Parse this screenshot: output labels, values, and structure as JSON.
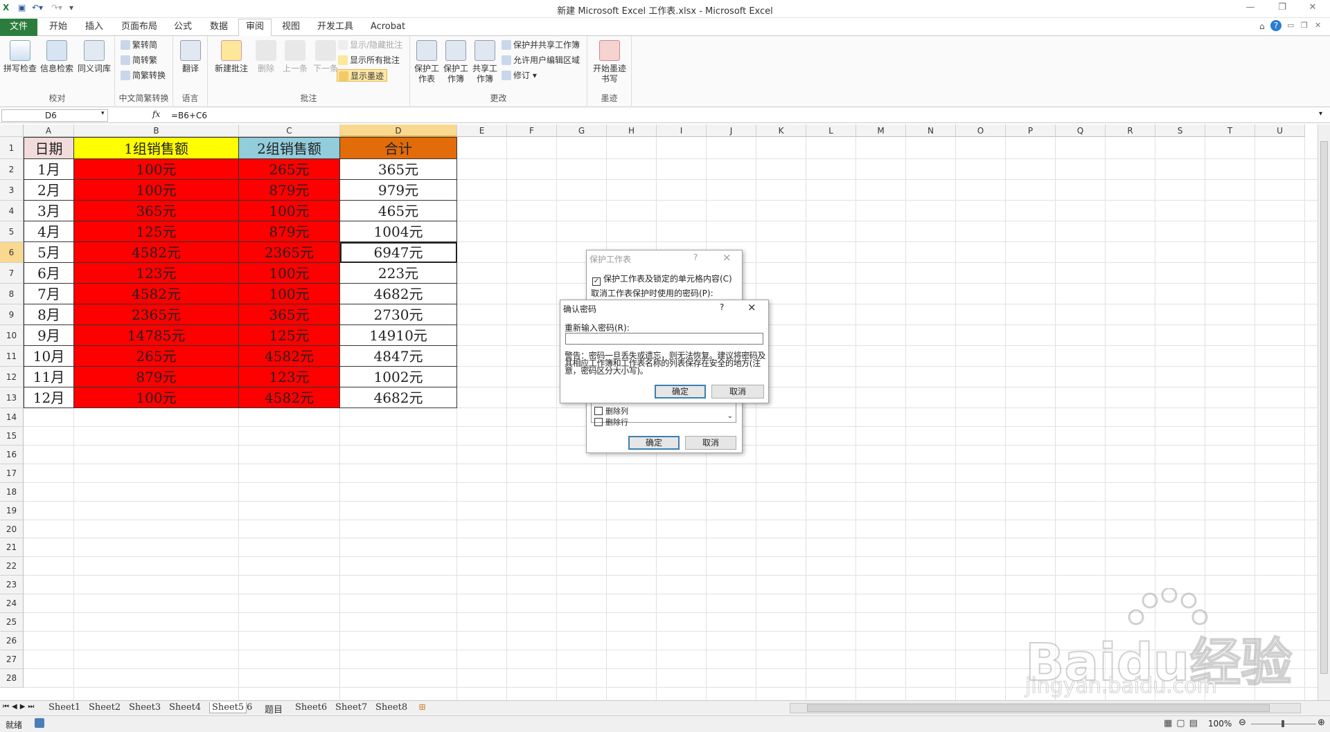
{
  "window": {
    "title": "新建 Microsoft Excel 工作表.xlsx - Microsoft Excel"
  },
  "tabs": [
    "文件",
    "开始",
    "插入",
    "页面布局",
    "公式",
    "数据",
    "审阅",
    "视图",
    "开发工具",
    "Acrobat"
  ],
  "active_tab": "审阅",
  "ribbon": {
    "proofing": {
      "label": "校对",
      "spell": "拼写检查",
      "research": "信息检索",
      "thesaurus": "同义词库"
    },
    "chinese": {
      "label": "中文简繁转换",
      "t2s": "繁转简",
      "s2t": "简转繁",
      "convert": "简繁转换"
    },
    "language": {
      "label": "语言",
      "translate": "翻译"
    },
    "comments": {
      "label": "批注",
      "new": "新建批注",
      "delete": "删除",
      "prev": "上一条",
      "next": "下一条",
      "show_hide": "显示/隐藏批注",
      "show_all": "显示所有批注",
      "show_ink": "显示墨迹"
    },
    "changes": {
      "label": "更改",
      "protect_sheet": "保护工作表",
      "protect_book": "保护工作簿",
      "share_book": "共享工作簿",
      "protect_share": "保护并共享工作簿",
      "allow_edit": "允许用户编辑区域",
      "track": "修订"
    },
    "ink": {
      "label": "墨迹",
      "start": "开始墨迹书写"
    }
  },
  "formula_bar": {
    "name_box": "D6",
    "fx": "fx",
    "formula": "=B6+C6"
  },
  "columns": [
    "A",
    "B",
    "C",
    "D",
    "E",
    "F",
    "G",
    "H",
    "I",
    "J",
    "K",
    "L",
    "M",
    "N",
    "O",
    "P",
    "Q",
    "R",
    "S",
    "T",
    "U"
  ],
  "rows": [
    "1",
    "2",
    "3",
    "4",
    "5",
    "6",
    "7",
    "8",
    "9",
    "10",
    "11",
    "12",
    "13",
    "14",
    "15",
    "16",
    "17",
    "18",
    "19",
    "20",
    "21",
    "22",
    "23",
    "24",
    "25",
    "26",
    "27",
    "28"
  ],
  "table": {
    "headers": [
      "日期",
      "1组销售额",
      "2组销售额",
      "合计"
    ],
    "data": [
      [
        "1月",
        "100元",
        "265元",
        "365元"
      ],
      [
        "2月",
        "100元",
        "879元",
        "979元"
      ],
      [
        "3月",
        "365元",
        "100元",
        "465元"
      ],
      [
        "4月",
        "125元",
        "879元",
        "1004元"
      ],
      [
        "5月",
        "4582元",
        "2365元",
        "6947元"
      ],
      [
        "6月",
        "123元",
        "100元",
        "223元"
      ],
      [
        "7月",
        "4582元",
        "100元",
        "4682元"
      ],
      [
        "8月",
        "2365元",
        "365元",
        "2730元"
      ],
      [
        "9月",
        "14785元",
        "125元",
        "14910元"
      ],
      [
        "10月",
        "265元",
        "4582元",
        "4847元"
      ],
      [
        "11月",
        "879元",
        "123元",
        "1002元"
      ],
      [
        "12月",
        "100元",
        "4582元",
        "4682元"
      ]
    ]
  },
  "colors": {
    "header_a": "#f2dcdb",
    "header_b": "#ffff00",
    "header_c": "#92cddc",
    "header_d": "#e26b0a",
    "red": "#ff0000"
  },
  "protect_dialog": {
    "title": "保护工作表",
    "help": "?",
    "close": "×",
    "check_label": "保护工作表及锁定的单元格内容(C)",
    "password_label": "取消工作表保护时使用的密码(P):",
    "list": [
      "删除列",
      "删除行"
    ],
    "ok": "确定",
    "cancel": "取消"
  },
  "confirm_dialog": {
    "title": "确认密码",
    "help": "?",
    "close": "×",
    "reenter_label": "重新输入密码(R):",
    "warning": "警告：密码一旦丢失或遗忘，则无法恢复。建议将密码及其相应工作簿和工作表名称的列表保存在安全的地方(注意，密码区分大小写)。",
    "ok": "确定",
    "cancel": "取消"
  },
  "sheets": [
    "Sheet1",
    "Sheet2",
    "Sheet3",
    "Sheet4",
    "Sheet5",
    "6",
    "题目",
    "Sheet6",
    "Sheet7",
    "Sheet8"
  ],
  "active_sheet": "Sheet5",
  "status": {
    "ready": "就绪",
    "zoom": "100%"
  },
  "watermark": {
    "logo": "Baidu经验",
    "url": "jingyan.baidu.com"
  }
}
